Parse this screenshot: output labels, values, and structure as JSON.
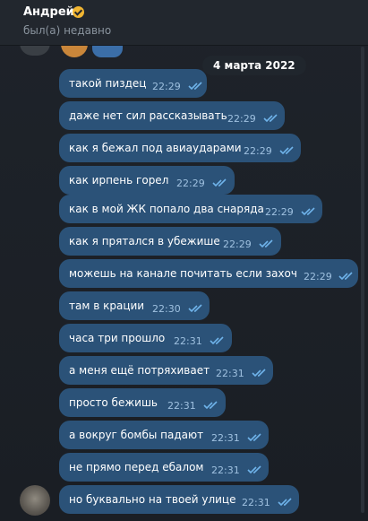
{
  "header": {
    "name": "Андрей",
    "status": "был(а) недавно"
  },
  "date_separator": "4 марта 2022",
  "messages": [
    {
      "text": "такой пиздец",
      "time": "22:29"
    },
    {
      "text": "даже нет сил рассказывать",
      "time": "22:29"
    },
    {
      "text": "как я бежал под авиаударами",
      "time": "22:29"
    },
    {
      "text": "как ирпень горел",
      "time": "22:29"
    },
    {
      "text": "как в мой ЖК попало два снаряда",
      "time": "22:29"
    },
    {
      "text": "как я прятался в убежише",
      "time": "22:29"
    },
    {
      "text": "можешь на канале почитать если захоч",
      "time": "22:29"
    },
    {
      "text": "там в крации",
      "time": "22:30"
    },
    {
      "text": "часа три прошло",
      "time": "22:31"
    },
    {
      "text": "а меня ещё потряхивает",
      "time": "22:31"
    },
    {
      "text": "просто бежишь",
      "time": "22:31"
    },
    {
      "text": "а вокруг бомбы падают",
      "time": "22:31"
    },
    {
      "text": "не прямо перед ебалом",
      "time": "22:31"
    },
    {
      "text": "но буквально на твоей улице",
      "time": "22:31"
    }
  ],
  "colors": {
    "bubble": "#2b5278",
    "tick": "#6fb3ea",
    "time": "#9fc1e0"
  }
}
